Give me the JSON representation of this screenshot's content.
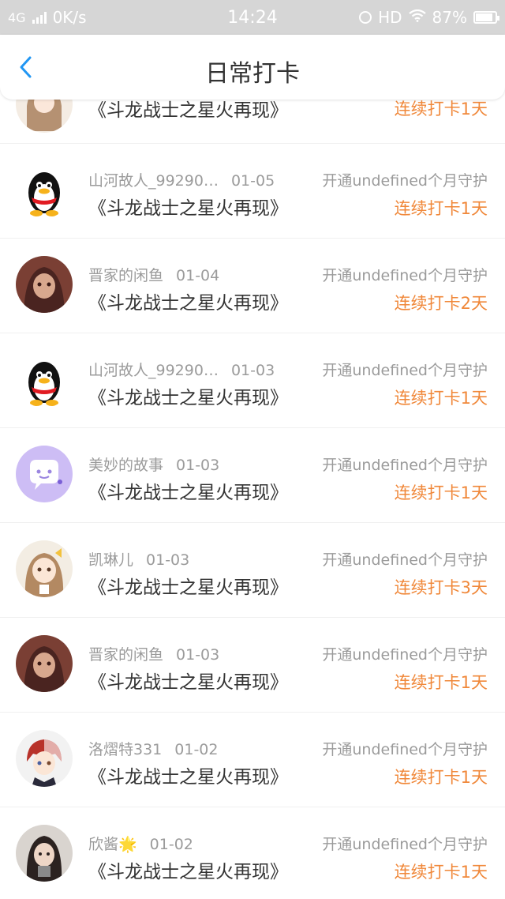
{
  "status_bar": {
    "network": "4G",
    "speed": "0K/s",
    "time": "14:24",
    "hd": "HD",
    "battery": "87%"
  },
  "header": {
    "title": "日常打卡"
  },
  "colors": {
    "accent": "#f0883a",
    "back": "#2196f3"
  },
  "rows": [
    {
      "name": "",
      "date": "",
      "content": "《斗龙战士之星火再现》",
      "guard": "",
      "streak": "连续打卡1天",
      "avatar": "anime-girl"
    },
    {
      "name": "山河故人_99290…",
      "date": "01-05",
      "content": "《斗龙战士之星火再现》",
      "guard": "开通undefined个月守护",
      "streak": "连续打卡1天",
      "avatar": "qq-penguin"
    },
    {
      "name": "晋家的闲鱼",
      "date": "01-04",
      "content": "《斗龙战士之星火再现》",
      "guard": "开通undefined个月守护",
      "streak": "连续打卡2天",
      "avatar": "dark-girl"
    },
    {
      "name": "山河故人_99290…",
      "date": "01-03",
      "content": "《斗龙战士之星火再现》",
      "guard": "开通undefined个月守护",
      "streak": "连续打卡1天",
      "avatar": "qq-penguin"
    },
    {
      "name": "美妙的故事",
      "date": "01-03",
      "content": "《斗龙战士之星火再现》",
      "guard": "开通undefined个月守护",
      "streak": "连续打卡1天",
      "avatar": "purple-chat"
    },
    {
      "name": "凯琳儿",
      "date": "01-03",
      "content": "《斗龙战士之星火再现》",
      "guard": "开通undefined个月守护",
      "streak": "连续打卡3天",
      "avatar": "anime-girl"
    },
    {
      "name": "晋家的闲鱼",
      "date": "01-03",
      "content": "《斗龙战士之星火再现》",
      "guard": "开通undefined个月守护",
      "streak": "连续打卡1天",
      "avatar": "dark-girl"
    },
    {
      "name": "洛熠特331",
      "date": "01-02",
      "content": "《斗龙战士之星火再现》",
      "guard": "开通undefined个月守护",
      "streak": "连续打卡1天",
      "avatar": "anime-boy"
    },
    {
      "name": "欣酱🌟",
      "date": "01-02",
      "content": "《斗龙战士之星火再现》",
      "guard": "开通undefined个月守护",
      "streak": "连续打卡1天",
      "avatar": "photo-girl"
    }
  ]
}
